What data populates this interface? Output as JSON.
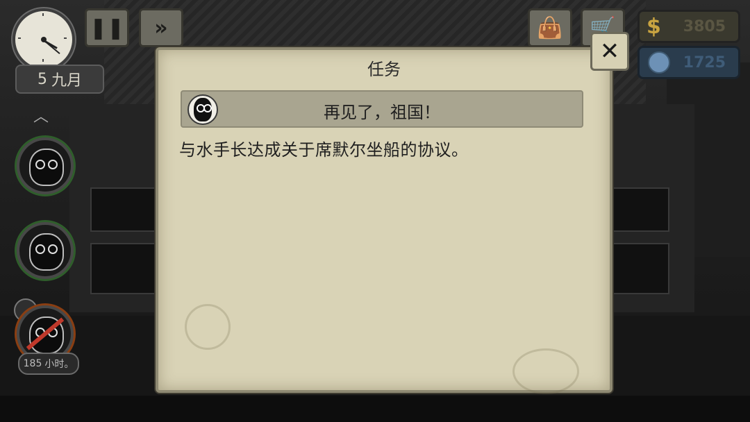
{
  "hud": {
    "date_day": "5",
    "date_month": "九月",
    "pause_icon": "pause-icon",
    "fast_forward_icon": "fast-forward-icon",
    "bag_icon": "bag-icon",
    "cart_icon": "cart-icon",
    "money_symbol": "$",
    "money_value": "3805",
    "gems_value": "1725"
  },
  "sidebar": {
    "hours_value": "185",
    "hours_unit": "小时。"
  },
  "dialog": {
    "title": "任务",
    "quest_name": "再见了，祖国！",
    "quest_description": "与水手长达成关于席默尔坐船的协议。",
    "close_label": "✕"
  }
}
